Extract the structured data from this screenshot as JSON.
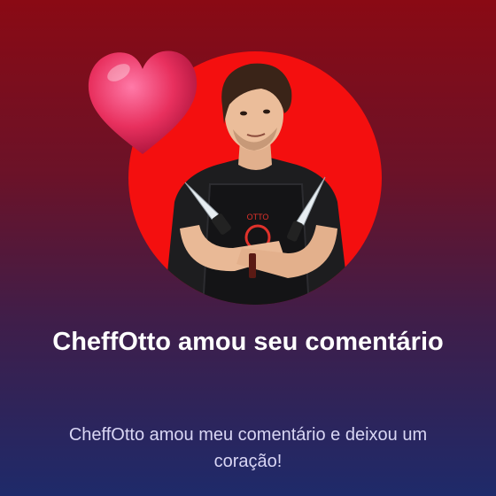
{
  "notification": {
    "title": "CheffOtto amou seu comentário",
    "message": "CheffOtto amou meu comentário e deixou um coração!",
    "avatar_apron_text": "OTTO"
  },
  "colors": {
    "avatar_bg": "#f40f0f",
    "heart": "#e8305e",
    "title_text": "#ffffff",
    "message_text": "#d9d6f4",
    "gradient_top": "#8a0a14",
    "gradient_bottom": "#1e2a6a"
  },
  "icons": {
    "heart": "heart-icon",
    "avatar": "chef-avatar"
  }
}
